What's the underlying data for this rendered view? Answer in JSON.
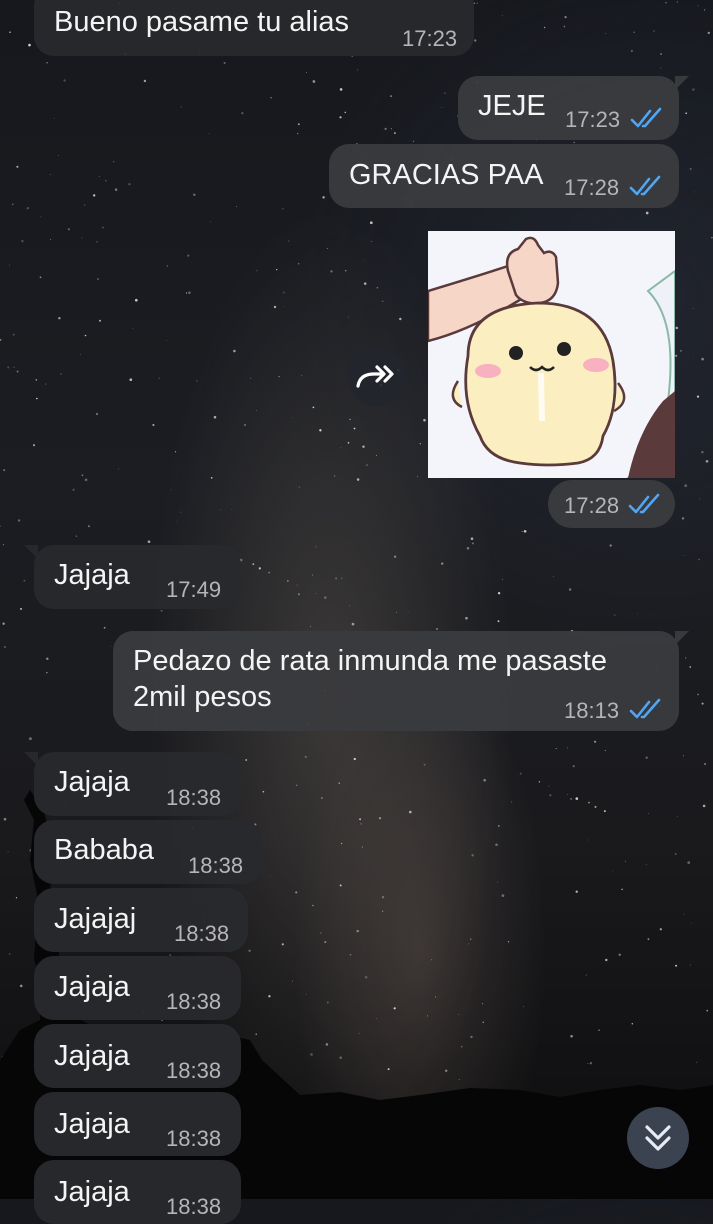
{
  "chat": {
    "messages": [
      {
        "direction": "in",
        "text": "Bueno pasame tu alias",
        "time": "17:23"
      },
      {
        "direction": "out",
        "text": "JEJE",
        "time": "17:23",
        "status": "read"
      },
      {
        "direction": "out",
        "text": "GRACIAS PAA",
        "time": "17:28",
        "status": "read"
      },
      {
        "direction": "out",
        "type": "sticker",
        "time": "17:28",
        "status": "read"
      },
      {
        "direction": "in",
        "text": "Jajaja",
        "time": "17:49"
      },
      {
        "direction": "out",
        "text_line1": "Pedazo de rata inmunda me pasaste",
        "text_line2": "2mil pesos",
        "time": "18:13",
        "status": "read"
      },
      {
        "direction": "in",
        "text": "Jajaja",
        "time": "18:38"
      },
      {
        "direction": "in",
        "text": "Bababa",
        "time": "18:38"
      },
      {
        "direction": "in",
        "text": "Jajajaj",
        "time": "18:38"
      },
      {
        "direction": "in",
        "text": "Jajaja",
        "time": "18:38"
      },
      {
        "direction": "in",
        "text": "Jajaja",
        "time": "18:38"
      },
      {
        "direction": "in",
        "text": "Jajaja",
        "time": "18:38"
      },
      {
        "direction": "in",
        "text": "Jajaja",
        "time": "18:38"
      }
    ]
  },
  "icons": {
    "read_status": "double-check-icon",
    "forward": "forward-icon",
    "scroll_down": "chevron-double-down-icon"
  },
  "colors": {
    "incoming_bubble": "#28292c",
    "outgoing_bubble": "#3a3b3e",
    "read_check": "#4ea6f5",
    "time_text": "#b5b5b5",
    "scroll_button": "#3b4350"
  }
}
